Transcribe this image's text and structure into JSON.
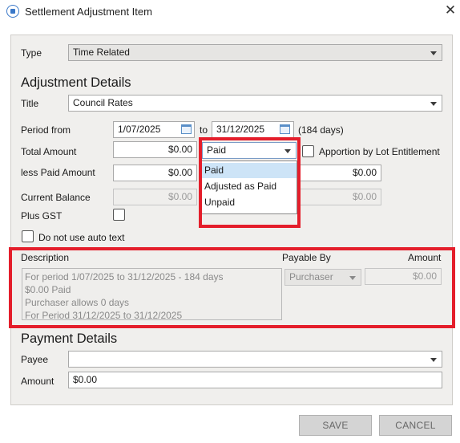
{
  "window": {
    "title": "Settlement Adjustment Item",
    "close_icon": "✕"
  },
  "type": {
    "label": "Type",
    "value": "Time Related"
  },
  "adjustment": {
    "heading": "Adjustment Details",
    "title_label": "Title",
    "title_value": "Council Rates",
    "period_label": "Period from",
    "period_from": "1/07/2025",
    "period_to_label": "to",
    "period_to": "31/12/2025",
    "period_days": "(184 days)",
    "total_amount_label": "Total Amount",
    "total_amount": "$0.00",
    "paid_status": "Paid",
    "apportion_label": "Apportion by Lot Entitlement",
    "apportion_checked": false,
    "less_paid_label": "less Paid Amount",
    "less_paid": "$0.00",
    "less_paid_right": "$0.00",
    "current_balance_label": "Current Balance",
    "current_balance": "$0.00",
    "current_balance_right": "$0.00",
    "plus_gst_label": "Plus GST",
    "plus_gst_checked": false,
    "no_auto_text_label": "Do not use auto text",
    "no_auto_text_checked": false
  },
  "dropdown": {
    "options": [
      "Paid",
      "Adjusted as Paid",
      "Unpaid"
    ],
    "selected": "Paid"
  },
  "description": {
    "header": "Description",
    "payable_by_header": "Payable By",
    "amount_header": "Amount",
    "lines": [
      "For period 1/07/2025 to 31/12/2025 - 184 days",
      "$0.00 Paid",
      "Purchaser allows 0 days",
      "For Period 31/12/2025 to 31/12/2025"
    ],
    "payable_by": "Purchaser",
    "amount": "$0.00"
  },
  "payment": {
    "heading": "Payment Details",
    "payee_label": "Payee",
    "payee_value": "",
    "amount_label": "Amount",
    "amount_value": "$0.00"
  },
  "buttons": {
    "save": "SAVE",
    "cancel": "CANCEL"
  },
  "colors": {
    "highlight_red": "#e41e2b",
    "selection_blue": "#cde4f7",
    "panel_bg": "#f0efed"
  }
}
